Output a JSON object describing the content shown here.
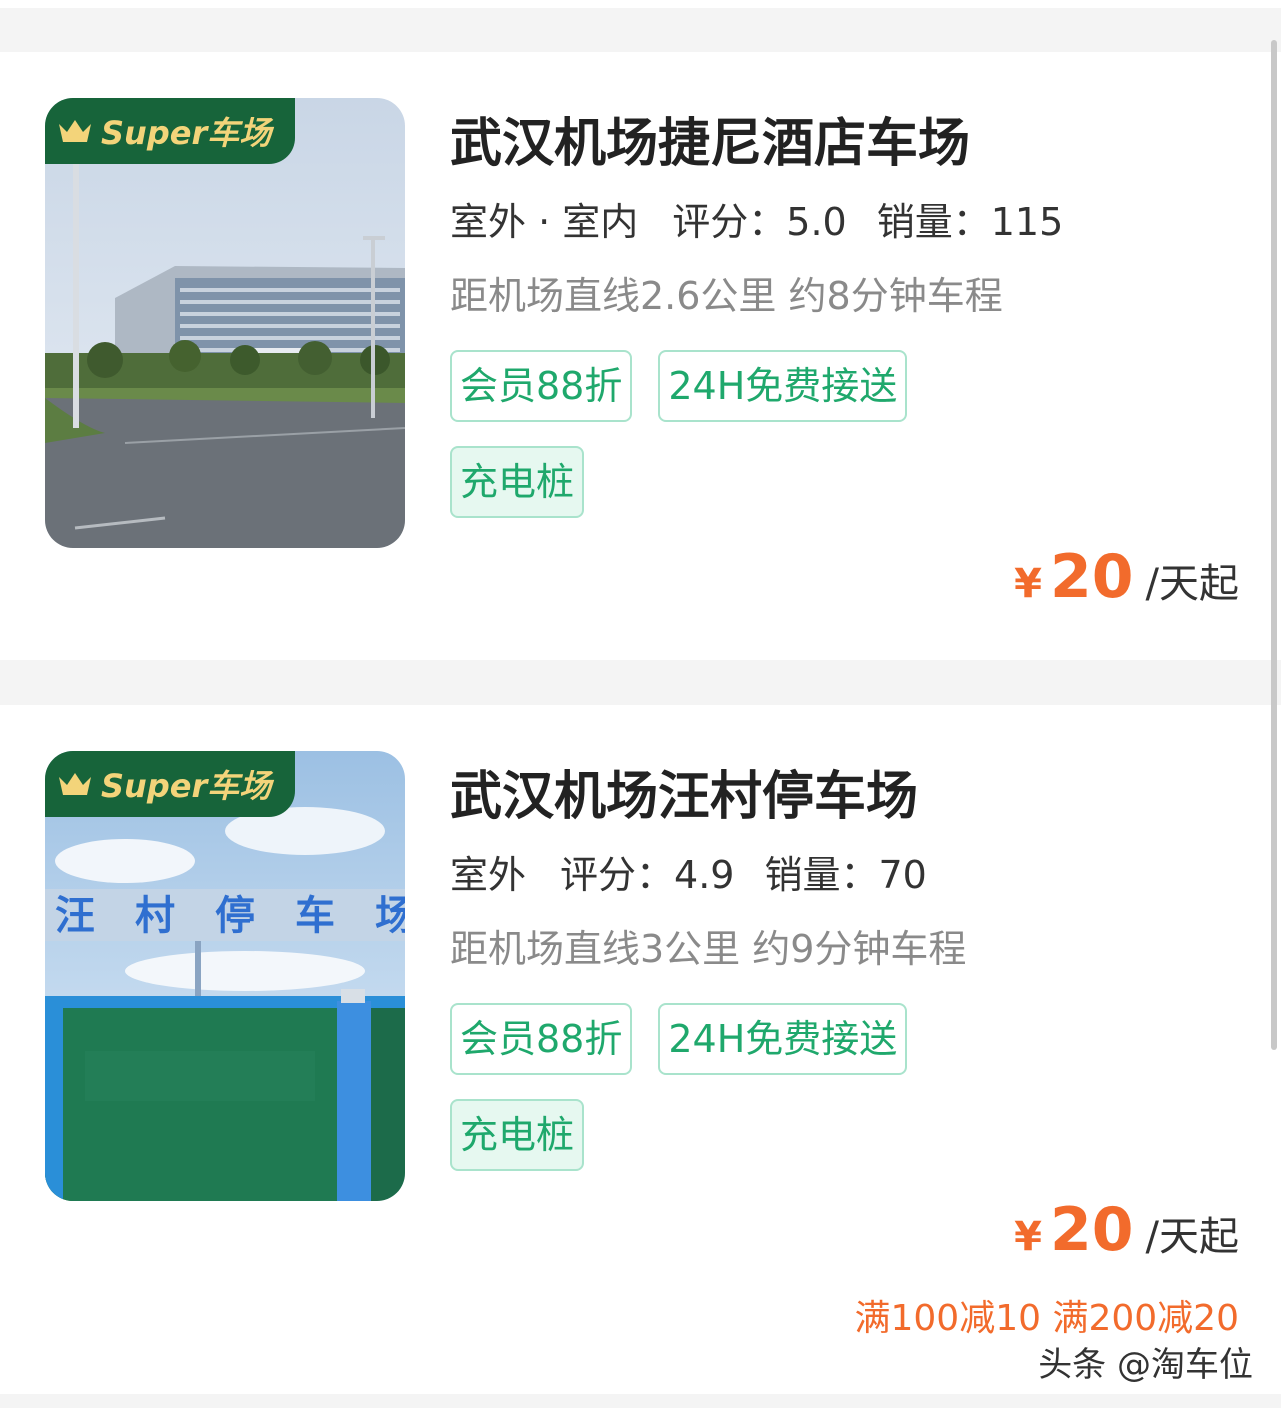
{
  "listings": [
    {
      "badge": "Super车场",
      "title": "武汉机场捷尼酒店车场",
      "location_type": "室外 · 室内",
      "rating_label": "评分：",
      "rating": "5.0",
      "sales_label": "销量：",
      "sales": "115",
      "distance": "距机场直线2.6公里 约8分钟车程",
      "tags": [
        "会员88折",
        "24H免费接送",
        "充电桩"
      ],
      "currency": "¥",
      "price": "20",
      "unit": "/天起"
    },
    {
      "badge": "Super车场",
      "title": "武汉机场汪村停车场",
      "location_type": "室外",
      "rating_label": "评分：",
      "rating": "4.9",
      "sales_label": "销量：",
      "sales": "70",
      "distance": "距机场直线3公里 约9分钟车程",
      "tags": [
        "会员88折",
        "24H免费接送",
        "充电桩"
      ],
      "currency": "¥",
      "price": "20",
      "unit": "/天起",
      "promo": "满100减10 满200减20",
      "sign_text": "汪村停车场"
    }
  ],
  "watermark": "头条 @淘车位",
  "colors": {
    "accent_green": "#1fa86c",
    "price_orange": "#f26b2c",
    "badge_green": "#17643a",
    "badge_gold": "#f3d47a"
  }
}
